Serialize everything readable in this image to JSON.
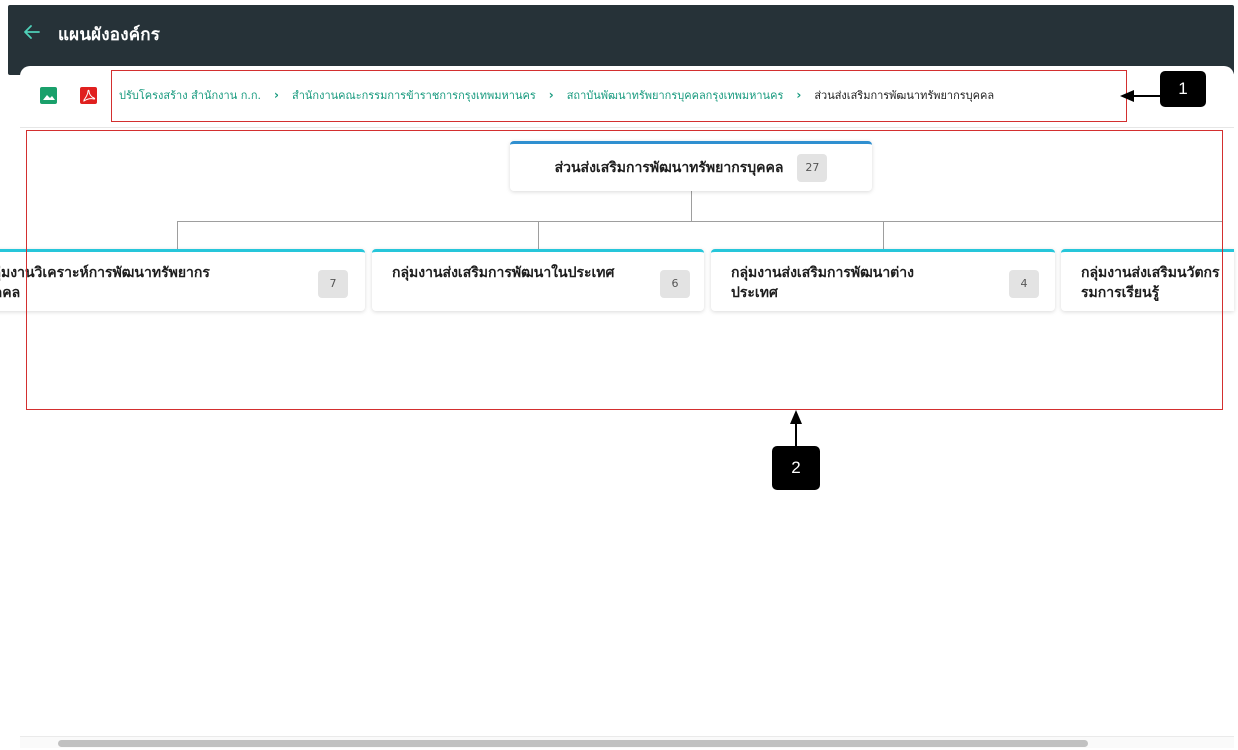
{
  "header": {
    "title": "แผนผังองค์กร",
    "back_icon": "arrow-left-icon"
  },
  "toolbar": {
    "image_icon": "image-icon",
    "pdf_icon": "pdf-icon",
    "breadcrumb": [
      "ปรับโครงสร้าง สำนักงาน ก.ก.",
      "สำนักงานคณะกรรมการข้าราชการกรุงเทพมหานคร",
      "สถาบันพัฒนาทรัพยากรบุคคลกรุงเทพมหานคร",
      "ส่วนส่งเสริมการพัฒนาทรัพยากรบุคคล"
    ],
    "separator": "›"
  },
  "org_chart": {
    "root": {
      "title": "ส่วนส่งเสริมการพัฒนาทรัพยากรบุคคล",
      "count": "27"
    },
    "children": [
      {
        "title": "กลุ่มงานวิเคราะห์การพัฒนาทรัพยากรบุคคล",
        "count": "7"
      },
      {
        "title": "กลุ่มงานส่งเสริมการพัฒนาในประเทศ",
        "count": "6"
      },
      {
        "title": "กลุ่มงานส่งเสริมการพัฒนาต่างประเทศ",
        "count": "4"
      },
      {
        "title": "กลุ่มงานส่งเสริมนวัตกรรมการเรียนรู้",
        "count": ""
      }
    ]
  },
  "annotations": {
    "label_1": "1",
    "label_2": "2"
  },
  "colors": {
    "header_bg": "#263238",
    "link": "#179a7e",
    "root_accent": "#2f8fd0",
    "child_accent": "#26c6da",
    "annotation": "#d32f2f"
  }
}
